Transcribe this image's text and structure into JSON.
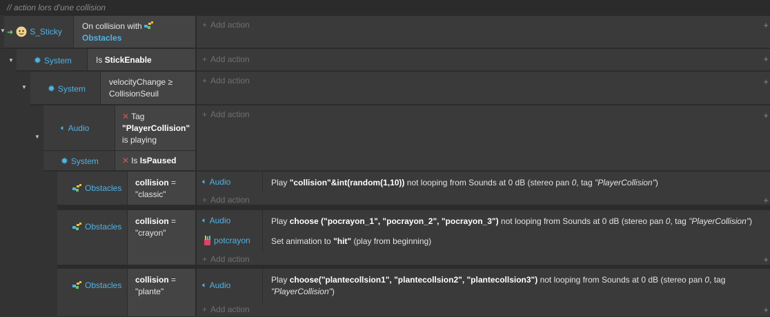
{
  "comment": "action lors d'une collision",
  "comment_prefix": "//",
  "add_action": "Add action",
  "event1": {
    "object": "S_Sticky",
    "condition_text": "On collision with",
    "condition_target": "Obstacles"
  },
  "event2": {
    "object": "System",
    "condition_prefix": "Is",
    "condition_bold": "StickEnable"
  },
  "event3": {
    "object": "System",
    "condition_line1": "velocityChange ≥",
    "condition_line2": "CollisionSeuil"
  },
  "event4": {
    "audio_object": "Audio",
    "audio_tag_label": "Tag",
    "audio_tag_value": "\"PlayerCollision\"",
    "audio_tag_suffix": "is playing",
    "system_object": "System",
    "system_prefix": "Is",
    "system_bold": "IsPaused"
  },
  "sub1": {
    "object": "Obstacles",
    "cond_bold": "collision",
    "cond_eq": "=",
    "cond_value": "\"classic\"",
    "action_object": "Audio",
    "action_prefix": "Play",
    "action_bold": "\"collision\"&int(random(1,10))",
    "action_middle": "not looping from Sounds at 0 dB (stereo pan",
    "action_pan": "0",
    "action_tag_text": ", tag",
    "action_tag": "\"PlayerCollision\"",
    "action_end": ")"
  },
  "sub2": {
    "object": "Obstacles",
    "cond_bold": "collision",
    "cond_eq": "=",
    "cond_value": "\"crayon\"",
    "action1_object": "Audio",
    "action1_prefix": "Play",
    "action1_bold": "choose (\"pocrayon_1\", \"pocrayon_2\", \"pocrayon_3\")",
    "action1_middle": "not looping from Sounds at 0 dB (stereo pan",
    "action1_pan": "0",
    "action1_tag_text": ", tag",
    "action1_tag": "\"PlayerCollision\"",
    "action1_end": ")",
    "action2_object": "potcrayon",
    "action2_prefix": "Set animation to",
    "action2_bold": "\"hit\"",
    "action2_end": "(play from beginning)"
  },
  "sub3": {
    "object": "Obstacles",
    "cond_bold": "collision",
    "cond_eq": "=",
    "cond_value": "\"plante\"",
    "action_object": "Audio",
    "action_prefix": "Play",
    "action_bold": "choose(\"plantecollsion1\", \"plantecollsion2\", \"plantecollsion3\")",
    "action_middle": "not looping from Sounds at 0 dB (stereo pan",
    "action_pan": "0",
    "action_tag_text": ", tag",
    "action_tag": "\"PlayerCollision\"",
    "action_end": ")"
  },
  "colors": {
    "background": "#2b2b2b",
    "accent": "#4fb3e6",
    "invert": "#e05252",
    "trigger": "#6fd36f"
  }
}
